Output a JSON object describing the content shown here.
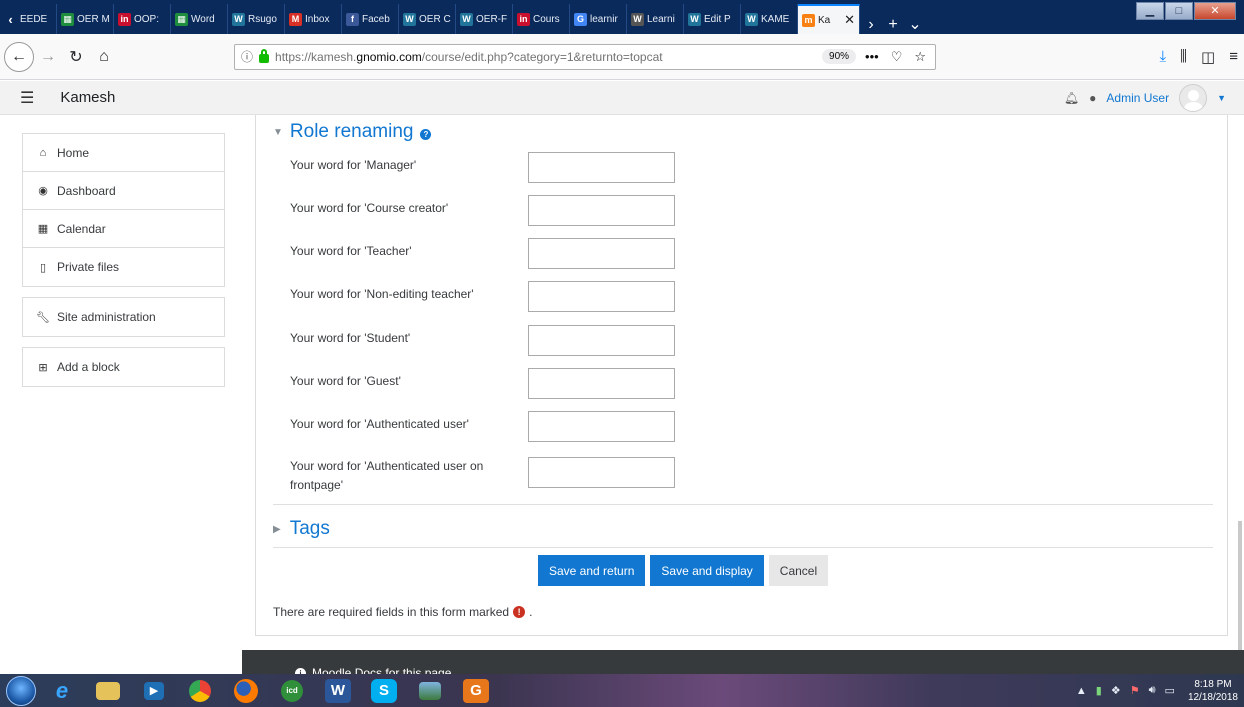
{
  "browser": {
    "tabs": [
      {
        "label": "EEDE",
        "icon": "back-chevron"
      },
      {
        "label": "OER M",
        "icon": "sheet-icon",
        "color": "#1e8e3e"
      },
      {
        "label": "OOP:",
        "icon": "in-icon",
        "color": "#c8102e"
      },
      {
        "label": "Word",
        "icon": "sheet-icon",
        "color": "#1e8e3e"
      },
      {
        "label": "Rsugo",
        "icon": "wordpress-icon",
        "color": "#21759b"
      },
      {
        "label": "Inbox",
        "icon": "gmail-icon",
        "color": "#d93025"
      },
      {
        "label": "Faceb",
        "icon": "facebook-icon",
        "color": "#3b5998"
      },
      {
        "label": "OER C",
        "icon": "wordpress-icon",
        "color": "#21759b"
      },
      {
        "label": "OER-F",
        "icon": "wordpress-icon",
        "color": "#21759b"
      },
      {
        "label": "Cours",
        "icon": "in-icon",
        "color": "#c8102e"
      },
      {
        "label": "learnir",
        "icon": "google-icon",
        "color": "#4285f4"
      },
      {
        "label": "Learni",
        "icon": "wiki-icon",
        "color": "#555555"
      },
      {
        "label": "Edit P",
        "icon": "wordpress-icon",
        "color": "#21759b"
      },
      {
        "label": "KAME",
        "icon": "wordpress-icon",
        "color": "#21759b"
      },
      {
        "label": "Ka",
        "icon": "moodle-icon",
        "color": "#f98012",
        "active": true
      }
    ],
    "url_prefix": "https://kamesh.",
    "url_host": "gnomio.com",
    "url_path": "/course/edit.php?category=1&returnto=topcat",
    "zoom": "90%"
  },
  "header": {
    "site_name": "Kamesh",
    "user_name": "Admin User"
  },
  "sidebar": {
    "nav": [
      {
        "label": "Home",
        "icon": "home-icon"
      },
      {
        "label": "Dashboard",
        "icon": "dashboard-icon"
      },
      {
        "label": "Calendar",
        "icon": "calendar-icon"
      },
      {
        "label": "Private files",
        "icon": "file-icon"
      }
    ],
    "admin": {
      "label": "Site administration",
      "icon": "wrench-icon"
    },
    "add_block": {
      "label": "Add a block",
      "icon": "plus-square-icon"
    }
  },
  "form": {
    "role_section_title": "Role renaming",
    "roles": [
      {
        "label": "Your word for 'Manager'",
        "value": ""
      },
      {
        "label": "Your word for 'Course creator'",
        "value": ""
      },
      {
        "label": "Your word for 'Teacher'",
        "value": ""
      },
      {
        "label": "Your word for 'Non-editing teacher'",
        "value": ""
      },
      {
        "label": "Your word for 'Student'",
        "value": ""
      },
      {
        "label": "Your word for 'Guest'",
        "value": ""
      },
      {
        "label": "Your word for 'Authenticated user'",
        "value": ""
      },
      {
        "label": "Your word for 'Authenticated user on frontpage'",
        "value": ""
      }
    ],
    "tags_title": "Tags",
    "buttons": {
      "save_return": "Save and return",
      "save_display": "Save and display",
      "cancel": "Cancel"
    },
    "required_note": "There are required fields in this form marked",
    "required_note_end": "."
  },
  "footer": {
    "docs_link": "Moodle Docs for this page"
  },
  "taskbar": {
    "time": "8:18 PM",
    "date": "12/18/2018"
  },
  "colors": {
    "accent": "#1177d1",
    "required": "#ca3120",
    "tabstrip": "#0a2a5c"
  }
}
